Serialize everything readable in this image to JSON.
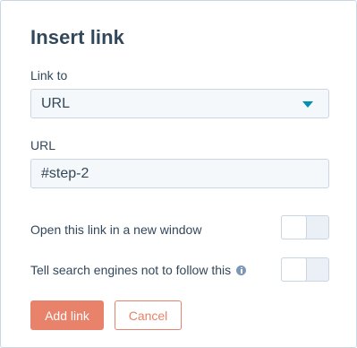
{
  "dialog": {
    "title": "Insert link",
    "link_to": {
      "label": "Link to",
      "selected": "URL"
    },
    "url": {
      "label": "URL",
      "value": "#step-2"
    },
    "toggles": [
      {
        "label": "Open this link in a new window",
        "on": false
      },
      {
        "label": "Tell search engines not to follow this",
        "on": false,
        "info_icon": "info-icon"
      }
    ],
    "buttons": {
      "primary": "Add link",
      "secondary": "Cancel"
    }
  },
  "colors": {
    "accent": "#e8826a",
    "text": "#33475b",
    "caret": "#0091ae",
    "field_bg": "#f5f8fa",
    "border": "#cbd6e2"
  }
}
